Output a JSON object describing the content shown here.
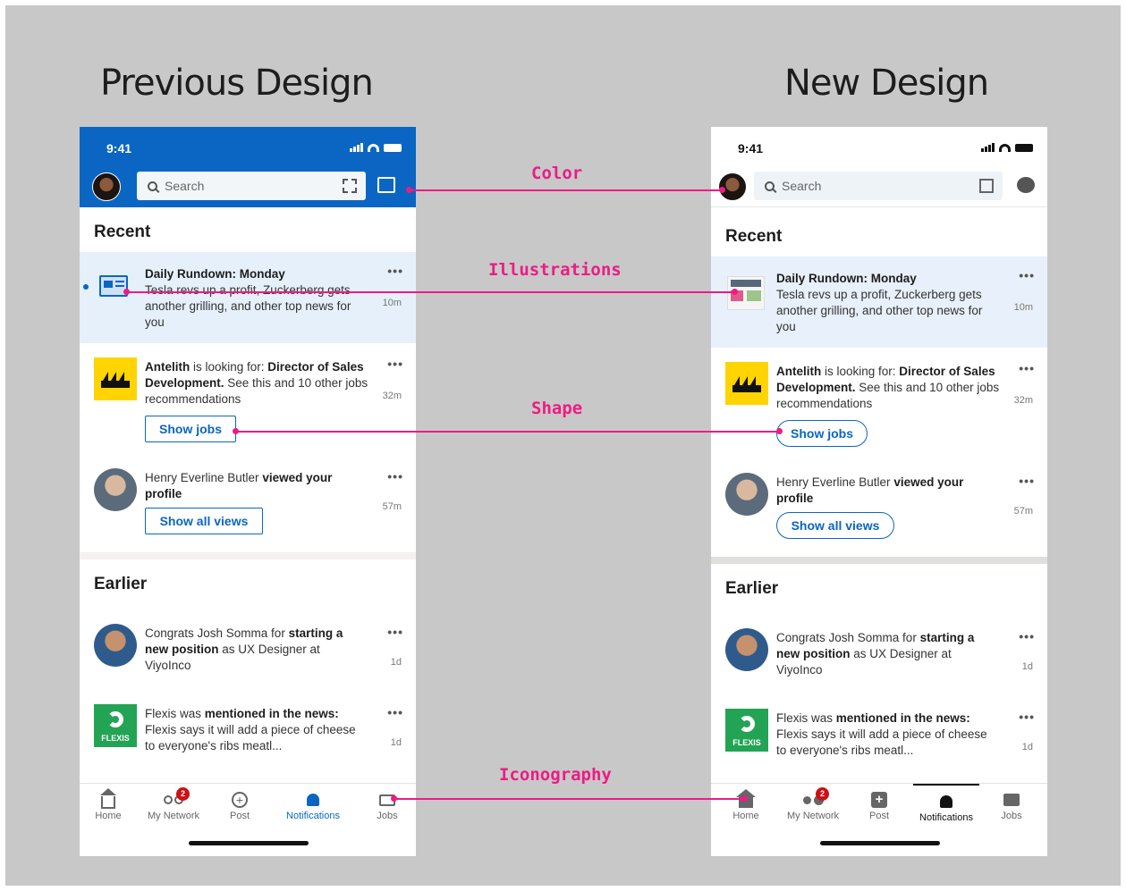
{
  "headings": {
    "left": "Previous Design",
    "right": "New Design"
  },
  "annotations": {
    "color": "Color",
    "illustrations": "Illustrations",
    "shape": "Shape",
    "iconography": "Iconography",
    "line_color": "#ec1c84"
  },
  "phone": {
    "status_time": "9:41",
    "search_placeholder": "Search",
    "recent_title": "Recent",
    "earlier_title": "Earlier",
    "notifications": {
      "rundown": {
        "title": "Daily Rundown: Monday",
        "body": "Tesla revs up a profit, Zuckerberg gets another grilling, and other top news for you",
        "time": "10m"
      },
      "job": {
        "company": "Antelith",
        "mid": " is looking for: ",
        "role": "Director of Sales Development.",
        "rest": " See this and 10 other jobs recommendations",
        "time": "32m",
        "button": "Show jobs"
      },
      "views": {
        "name": "Henry Everline Butler ",
        "action": "viewed your profile",
        "time": "57m",
        "button": "Show all views"
      },
      "congrats": {
        "lead": "Congrats Josh Somma for ",
        "bold": "starting a new position",
        "rest": " as UX Designer at ViyoInco",
        "time": "1d"
      },
      "flexis": {
        "lead": "Flexis was ",
        "bold": "mentioned in the news:",
        "rest": " Flexis says it will add a piece of cheese to everyone's ribs meatl...",
        "time": "1d",
        "logo_text": "FLEXIS"
      }
    },
    "nav": {
      "home": "Home",
      "network": "My Network",
      "network_badge": "2",
      "post": "Post",
      "notifications": "Notifications",
      "jobs": "Jobs"
    }
  },
  "colors": {
    "old_header": "#0a66c2",
    "new_header": "#ffffff",
    "highlight_old": "#e6f0fa",
    "highlight_new": "#e8f0fb",
    "accent": "#0a66c2",
    "job_logo": "#ffd400",
    "flexis_logo": "#23a455"
  }
}
